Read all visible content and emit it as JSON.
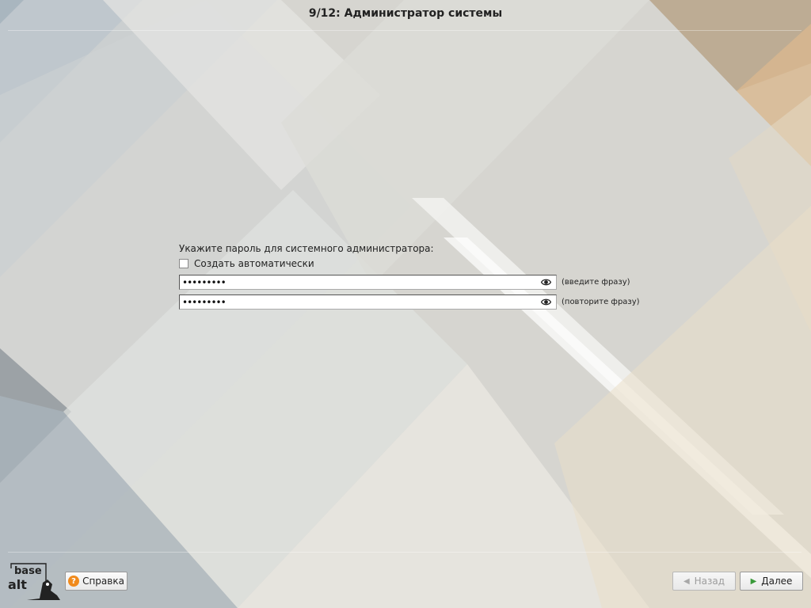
{
  "header": {
    "title": "9/12: Администратор системы"
  },
  "form": {
    "prompt": "Укажите пароль для системного администратора:",
    "auto_generate_label": "Создать автоматически",
    "password_field": {
      "value": "•••••••••",
      "hint": "(введите фразу)"
    },
    "confirm_field": {
      "value": "•••••••••",
      "hint": "(повторите фразу)"
    }
  },
  "logo": {
    "line1": "base",
    "line2": "alt"
  },
  "footer": {
    "help_label": "Справка",
    "help_glyph": "?",
    "back_label": "Назад",
    "next_label": "Далее"
  },
  "icons": {
    "eye": "eye-icon",
    "help": "help-icon",
    "back": "chevron-left-icon",
    "next": "chevron-right-icon"
  },
  "colors": {
    "help_icon": "#f08a1c",
    "next_arrow": "#3a9a3a",
    "disabled_text": "#9c9c9c"
  }
}
